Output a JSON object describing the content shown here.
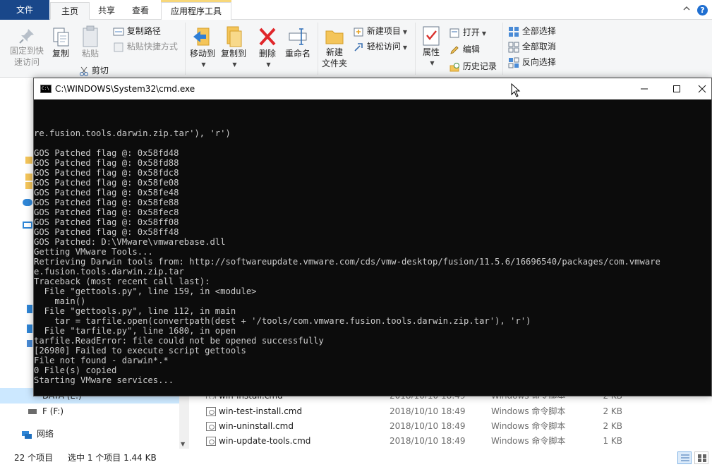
{
  "ribbon": {
    "tabs": {
      "file": "文件",
      "home": "主页",
      "share": "共享",
      "view": "查看",
      "app_tools": "应用程序工具"
    },
    "clipboard": {
      "pin": "固定到快",
      "pin2": "速访问",
      "copy": "复制",
      "paste": "粘贴",
      "copy_path": "复制路径",
      "paste_shortcut": "粘贴快捷方式",
      "cut": "剪切"
    },
    "organize": {
      "move_to": "移动到",
      "copy_to": "复制到",
      "delete": "删除",
      "rename": "重命名"
    },
    "new": {
      "new_folder": "新建",
      "new_folder2": "文件夹",
      "new_item": "新建项目",
      "easy_access": "轻松访问"
    },
    "open": {
      "properties": "属性",
      "open": "打开",
      "edit": "编辑",
      "history": "历史记录"
    },
    "select": {
      "select_all": "全部选择",
      "select_none": "全部取消",
      "invert": "反向选择"
    }
  },
  "nav_pane": {
    "items": [
      {
        "label": "DATA (E:)"
      },
      {
        "label": "F (F:)"
      },
      {
        "label": "网络"
      }
    ]
  },
  "files": [
    {
      "name": "win-install.cmd",
      "date": "2018/10/10 18:49",
      "type": "Windows 命令脚本",
      "size": "2 KB"
    },
    {
      "name": "win-test-install.cmd",
      "date": "2018/10/10 18:49",
      "type": "Windows 命令脚本",
      "size": "2 KB"
    },
    {
      "name": "win-uninstall.cmd",
      "date": "2018/10/10 18:49",
      "type": "Windows 命令脚本",
      "size": "2 KB"
    },
    {
      "name": "win-update-tools.cmd",
      "date": "2018/10/10 18:49",
      "type": "Windows 命令脚本",
      "size": "1 KB"
    }
  ],
  "status": {
    "count": "22 个项目",
    "selected": "选中 1 个项目  1.44 KB"
  },
  "cmd": {
    "title": "C:\\WINDOWS\\System32\\cmd.exe",
    "lines": [
      "re.fusion.tools.darwin.zip.tar'), 'r')",
      "",
      "GOS Patched flag @: 0x58fd48",
      "GOS Patched flag @: 0x58fd88",
      "GOS Patched flag @: 0x58fdc8",
      "GOS Patched flag @: 0x58fe08",
      "GOS Patched flag @: 0x58fe48",
      "GOS Patched flag @: 0x58fe88",
      "GOS Patched flag @: 0x58fec8",
      "GOS Patched flag @: 0x58ff08",
      "GOS Patched flag @: 0x58ff48",
      "GOS Patched: D:\\VMware\\vmwarebase.dll",
      "Getting VMware Tools...",
      "Retrieving Darwin tools from: http://softwareupdate.vmware.com/cds/vmw-desktop/fusion/11.5.6/16696540/packages/com.vmware",
      "e.fusion.tools.darwin.zip.tar",
      "Traceback (most recent call last):",
      "  File \"gettools.py\", line 159, in <module>",
      "    main()",
      "  File \"gettools.py\", line 112, in main",
      "    tar = tarfile.open(convertpath(dest + '/tools/com.vmware.fusion.tools.darwin.zip.tar'), 'r')",
      "  File \"tarfile.py\", line 1680, in open",
      "tarfile.ReadError: file could not be opened successfully",
      "[26980] Failed to execute script gettools",
      "File not found - darwin*.*",
      "0 File(s) copied",
      "Starting VMware services..."
    ]
  }
}
